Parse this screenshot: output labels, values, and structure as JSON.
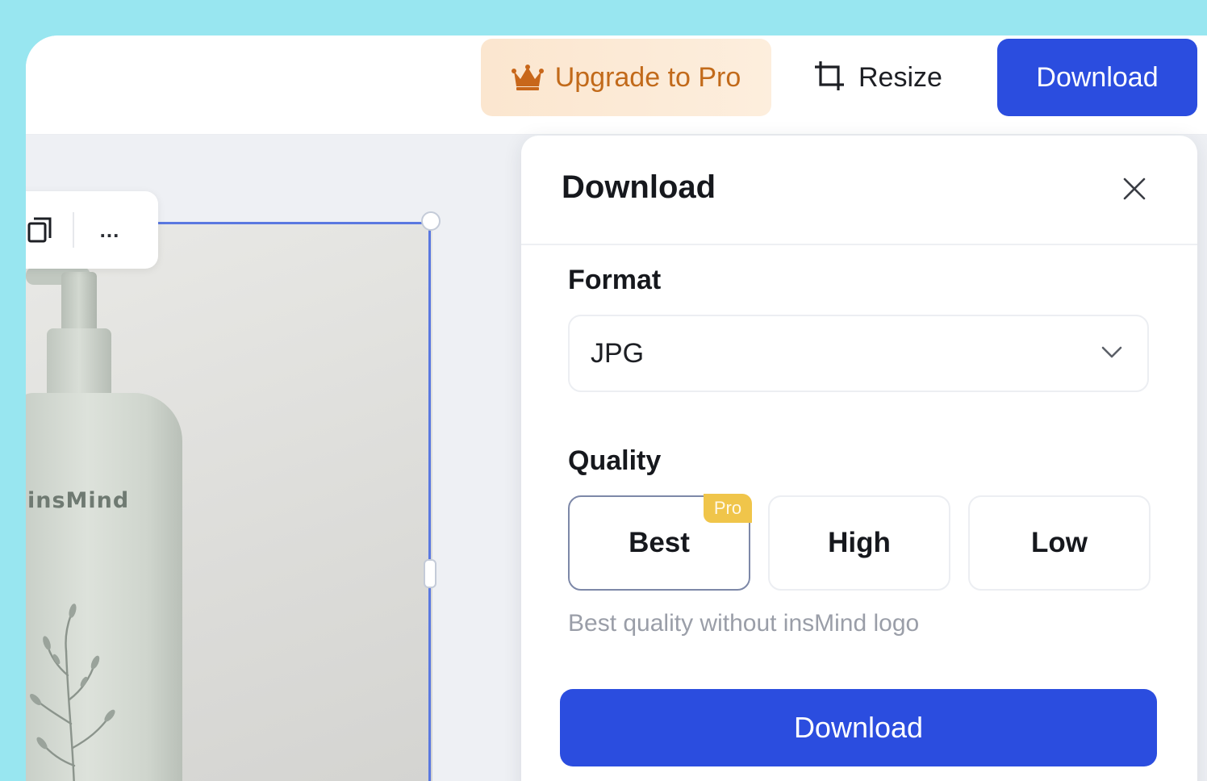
{
  "colors": {
    "background": "#98e6f0",
    "primary": "#2b4ddf",
    "upgrade_text": "#c26a1a",
    "pro_badge": "#f0c54a"
  },
  "topbar": {
    "upgrade_label": "Upgrade to Pro",
    "upgrade_icon": "crown-icon",
    "resize_label": "Resize",
    "resize_icon": "crop-icon",
    "download_label": "Download"
  },
  "canvas": {
    "toolbar": {
      "more_label": "...",
      "icons": [
        "copy-icon",
        "more-icon"
      ]
    },
    "product": {
      "brand_text": "insMind"
    }
  },
  "download_panel": {
    "title": "Download",
    "close_icon": "close-icon",
    "format": {
      "label": "Format",
      "value": "JPG"
    },
    "quality": {
      "label": "Quality",
      "options": [
        {
          "label": "Best",
          "badge": "Pro",
          "selected": true
        },
        {
          "label": "High",
          "selected": false
        },
        {
          "label": "Low",
          "selected": false
        }
      ],
      "description": "Best quality without insMind logo"
    },
    "download_label": "Download"
  }
}
